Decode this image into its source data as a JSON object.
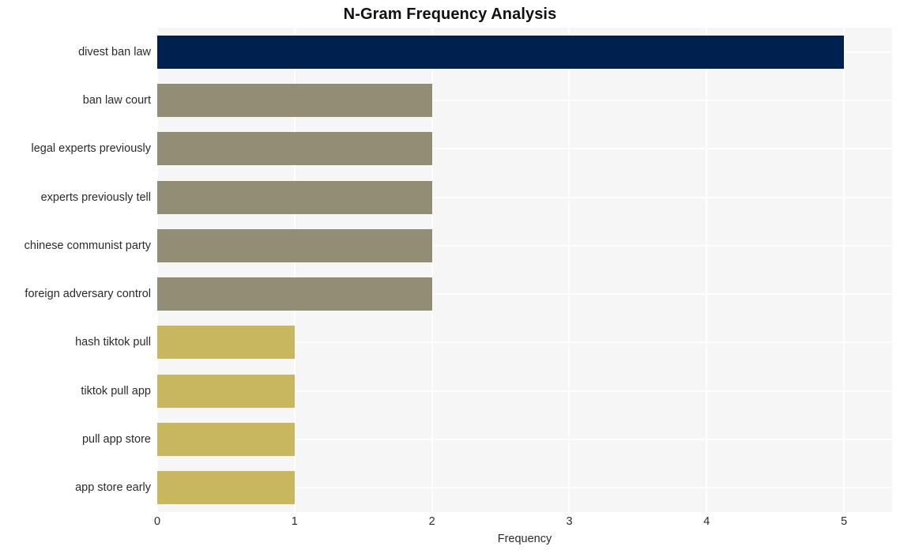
{
  "chart_data": {
    "type": "bar",
    "orientation": "horizontal",
    "title": "N-Gram Frequency Analysis",
    "xlabel": "Frequency",
    "ylabel": "",
    "categories": [
      "divest ban law",
      "ban law court",
      "legal experts previously",
      "experts previously tell",
      "chinese communist party",
      "foreign adversary control",
      "hash tiktok pull",
      "tiktok pull app",
      "pull app store",
      "app store early"
    ],
    "values": [
      5,
      2,
      2,
      2,
      2,
      2,
      1,
      1,
      1,
      1
    ],
    "bar_colors": [
      "#002050",
      "#928e75",
      "#928e75",
      "#928e75",
      "#928e75",
      "#928e75",
      "#c9b75f",
      "#c9b75f",
      "#c9b75f",
      "#c9b75f"
    ],
    "xlim": [
      0,
      5.35
    ],
    "xticks": [
      "0",
      "1",
      "2",
      "3",
      "4",
      "5"
    ],
    "xtick_values": [
      0,
      1,
      2,
      3,
      4,
      5
    ],
    "grid": true,
    "grid_color": "#ffffff",
    "legend": "none",
    "plot_background": "#f6f6f7",
    "figure_background": "#ffffff",
    "title_color": "#111111",
    "tick_label_color": "#2b2b2b"
  }
}
